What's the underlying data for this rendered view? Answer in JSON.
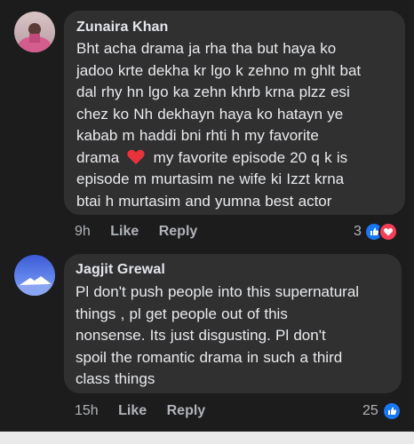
{
  "comments": [
    {
      "author": "Zunaira Khan",
      "lines": [
        "Bht acha drama ja rha tha but haya ko",
        "jadoo krte dekha kr lgo k zehno m ghlt bat",
        "dal rhy hn lgo ka zehn khrb krna plzz esi",
        "chez ko Nh dekhayn haya ko hatayn ye",
        "kabab m haddi bni rhti h my favorite",
        "drama",
        "my favorite episode 20 q k is",
        "episode m murtasim ne wife ki Izzt krna",
        "btai h murtasim and yumna best actor"
      ],
      "time": "9h",
      "like_label": "Like",
      "reply_label": "Reply",
      "reaction_count": "3",
      "reactions": [
        "like-icon",
        "heart-icon"
      ]
    },
    {
      "author": "Jagjit Grewal",
      "lines": [
        "Pl don't push people into this supernatural",
        "things , pl get people out of this",
        "nonsense.  Its just  disgusting.  Pl don't",
        "spoil the romantic drama in such a third",
        "class things"
      ],
      "time": "15h",
      "like_label": "Like",
      "reply_label": "Reply",
      "reaction_count": "25",
      "reactions": [
        "like-icon"
      ]
    }
  ],
  "colors": {
    "background": "#1c1c1d",
    "bubble": "#303031",
    "like_blue": "#1877f2",
    "heart_red": "#f33e58"
  }
}
